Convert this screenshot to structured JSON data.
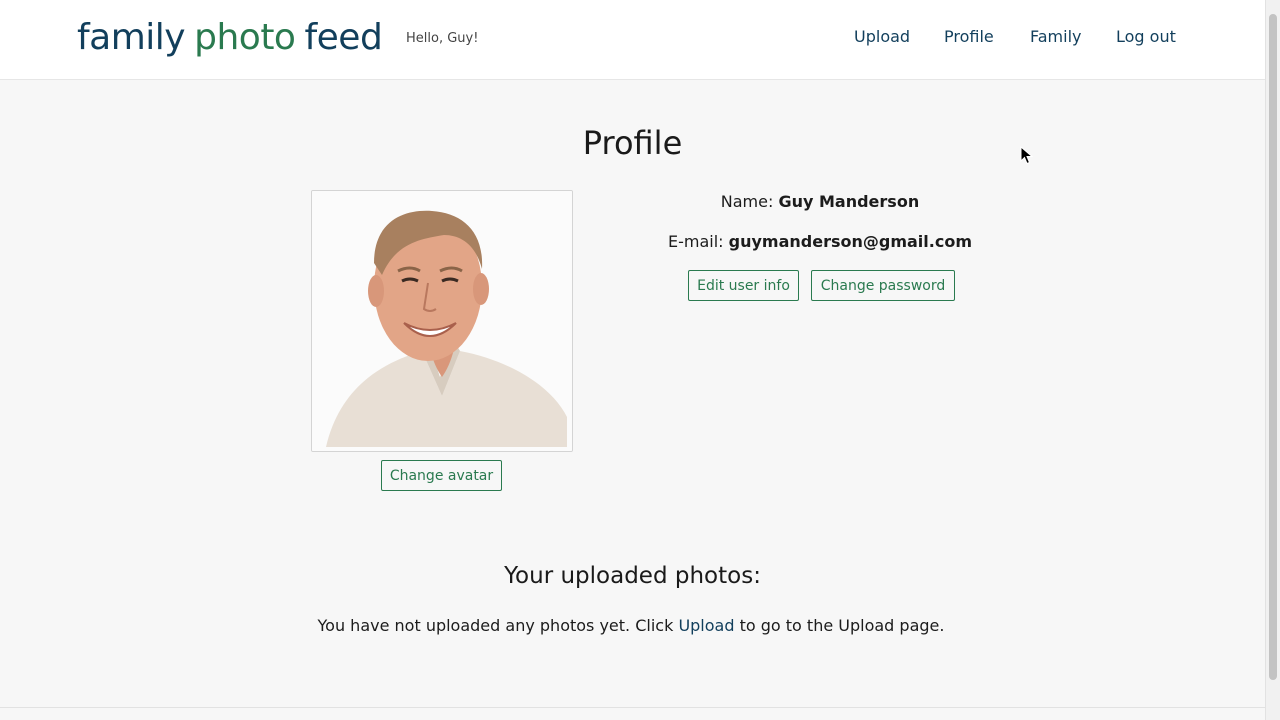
{
  "header": {
    "logo": {
      "word1": "family",
      "word2": "photo",
      "word3": "feed"
    },
    "greeting": "Hello, Guy!",
    "nav": [
      {
        "label": "Upload"
      },
      {
        "label": "Profile"
      },
      {
        "label": "Family"
      },
      {
        "label": "Log out"
      }
    ]
  },
  "main": {
    "title": "Profile",
    "avatar": {
      "button_label": "Change avatar"
    },
    "user": {
      "name_label": "Name:",
      "name_value": "Guy Manderson",
      "email_label": "E-mail:",
      "email_value": "guymanderson@gmail.com"
    },
    "buttons": {
      "edit_user_info": "Edit user info",
      "change_password": "Change password"
    },
    "uploads": {
      "title": "Your uploaded photos:",
      "message_before": "You have not uploaded any photos yet. Click",
      "link_label": "Upload",
      "message_after": "to go to the Upload page."
    }
  },
  "colors": {
    "brand_dark": "#123f5c",
    "brand_green": "#2a7a4f",
    "background": "#f7f7f7"
  },
  "icons": [
    "mouse-pointer-icon"
  ]
}
